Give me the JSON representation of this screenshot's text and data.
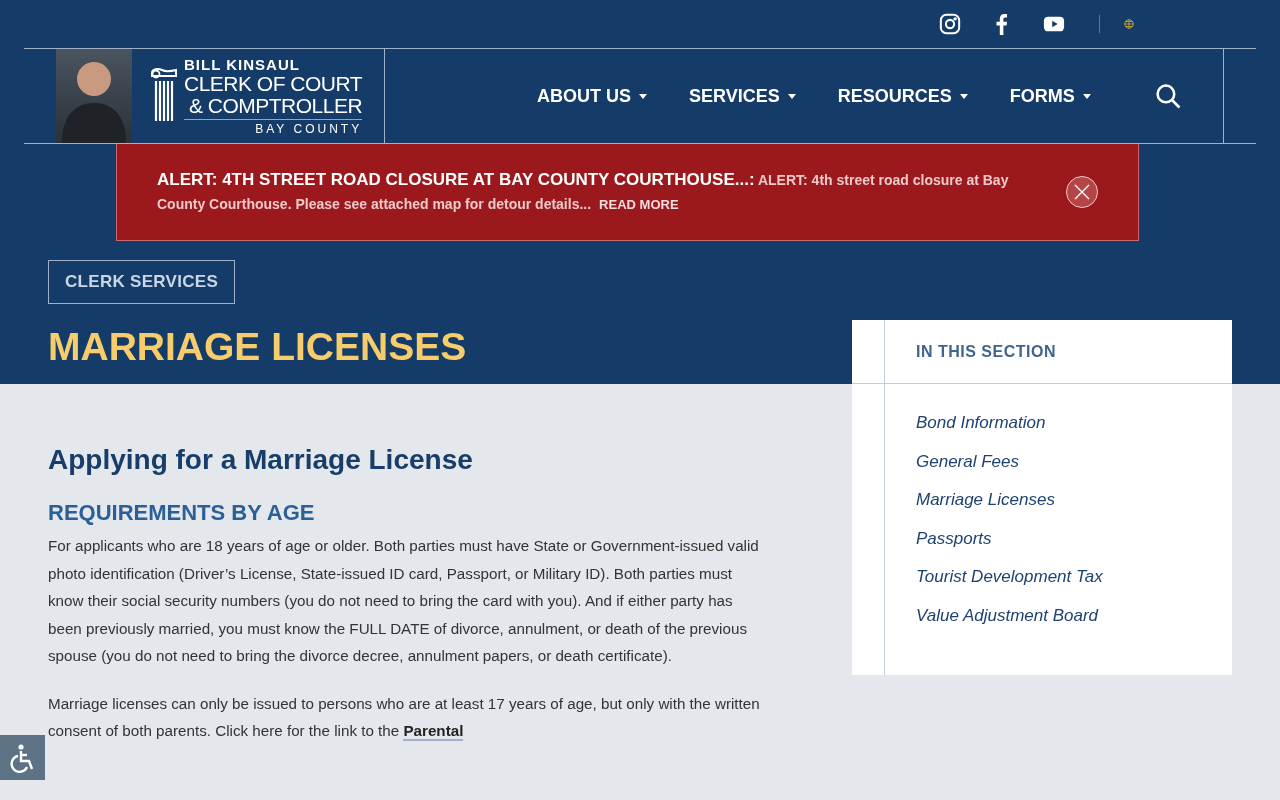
{
  "header": {
    "logo": {
      "name": "BILL KINSAUL",
      "line_1": "CLERK OF COURT",
      "line_2": "& COMPTROLLER",
      "county": "BAY COUNTY"
    },
    "nav": [
      {
        "label": "ABOUT US"
      },
      {
        "label": "SERVICES"
      },
      {
        "label": "RESOURCES"
      },
      {
        "label": "FORMS"
      }
    ]
  },
  "alert": {
    "title": "ALERT: 4TH STREET ROAD CLOSURE AT BAY COUNTY COURTHOUSE...:",
    "text": "ALERT: 4th street road closure at Bay County Courthouse. Please see attached map for detour details...",
    "link": "READ MORE"
  },
  "breadcrumb": "CLERK SERVICES",
  "page_title": "MARRIAGE LICENSES",
  "content": {
    "heading": "Applying for a Marriage License",
    "subheading": "REQUIREMENTS BY AGE",
    "paragraphs": [
      {
        "text": "For applicants who are 18 years of age or older. Both parties must have State or Government-issued valid photo identification (Driver’s License, State-issued ID card, Passport, or Military ID). Both parties must know their social security numbers (you do not need to bring the card with you). And if either party has been previously married, you must know the FULL DATE of divorce, annulment, or death of the previous spouse (you do not need to bring the divorce decree, annulment papers, or death certificate)."
      },
      {
        "text": "Marriage licenses can only be issued to persons who are at least 17 years of age, but only with the written consent of both parents. Click here for the link to the ",
        "link": "Parental"
      }
    ]
  },
  "sidebar": {
    "heading": "IN THIS SECTION",
    "items": [
      {
        "label": "Bond Information"
      },
      {
        "label": "General Fees"
      },
      {
        "label": "Marriage Licenses"
      },
      {
        "label": "Passports"
      },
      {
        "label": "Tourist Development Tax"
      },
      {
        "label": "Value Adjustment Board"
      }
    ]
  }
}
